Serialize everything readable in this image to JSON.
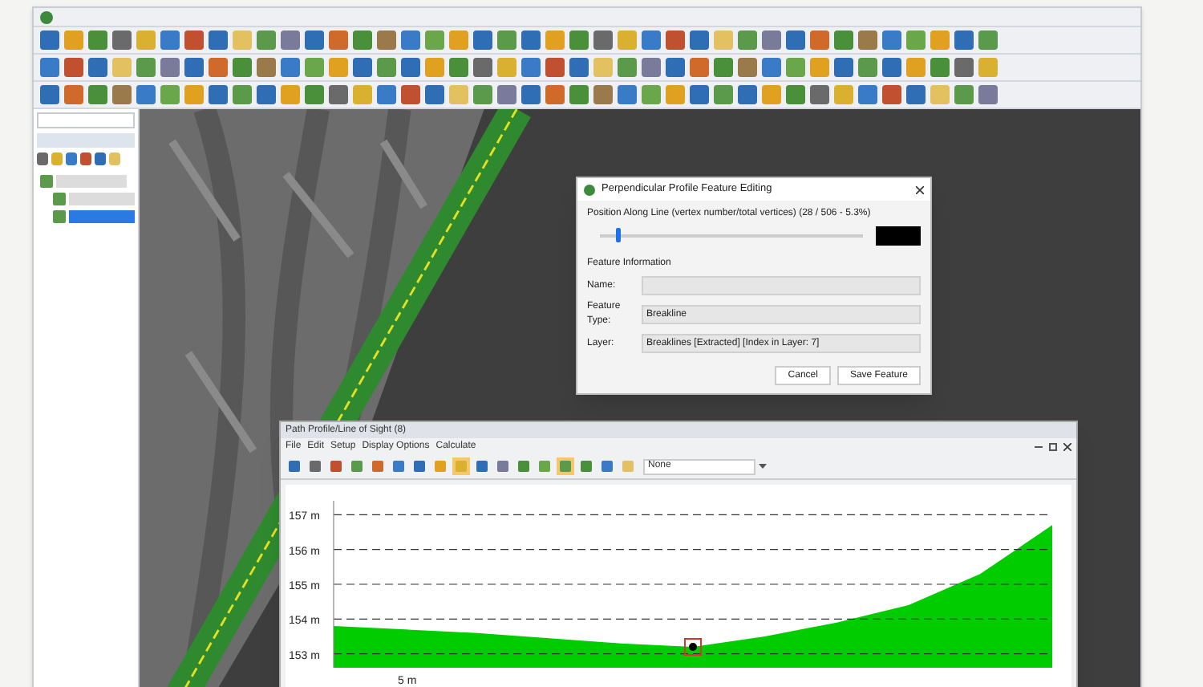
{
  "tree": {
    "items": [
      {
        "selected": false,
        "children": [
          {
            "selected": false
          },
          {
            "selected": true
          }
        ]
      }
    ]
  },
  "dialog": {
    "title": "Perpendicular Profile Feature Editing",
    "position_label": "Position Along Line (vertex number/total vertices) (28 / 506 - 5.3%)",
    "position": {
      "level": 0.06
    },
    "section_title": "Feature Information",
    "fields": [
      {
        "label": "Name:"
      },
      {
        "label": "Feature Type:",
        "value": "Breakline"
      },
      {
        "label": "Layer:",
        "value": "Breaklines [Extracted] [Index in Layer: 7]"
      }
    ],
    "buttons": [
      "Cancel",
      "Save Feature"
    ]
  },
  "profile": {
    "title": "Path Profile/Line of Sight (8)",
    "menu": [
      "File",
      "Edit",
      "Setup",
      "Display Options",
      "Calculate"
    ],
    "tools": [
      {
        "selected": false
      },
      {
        "selected": false
      },
      {
        "selected": false
      },
      {
        "selected": false
      },
      {
        "selected": false
      },
      {
        "selected": false
      },
      {
        "selected": false
      },
      {
        "selected": false
      },
      {
        "selected": true
      },
      {
        "selected": false
      },
      {
        "selected": false
      },
      {
        "selected": false
      },
      {
        "selected": false
      },
      {
        "selected": true
      },
      {
        "selected": false
      },
      {
        "selected": false
      },
      {
        "selected": false
      }
    ],
    "dropdown": {
      "value": "None"
    },
    "chart_data": {
      "type": "area",
      "grid": true,
      "series": [
        {
          "color": "#00cc00",
          "values": [
            153.8,
            153.7,
            153.6,
            153.45,
            153.3,
            153.2,
            153.5,
            153.9,
            154.4,
            155.3,
            156.7
          ]
        }
      ],
      "annotations": [
        "5 m"
      ],
      "ylim": [
        152.6,
        157.4
      ],
      "yticks": [
        {
          "value": 157,
          "label": "157 m"
        },
        {
          "value": 156,
          "label": "156 m"
        },
        {
          "value": 155,
          "label": "155 m"
        },
        {
          "value": 154,
          "label": "154 m"
        },
        {
          "value": 153,
          "label": "153 m"
        }
      ]
    }
  }
}
